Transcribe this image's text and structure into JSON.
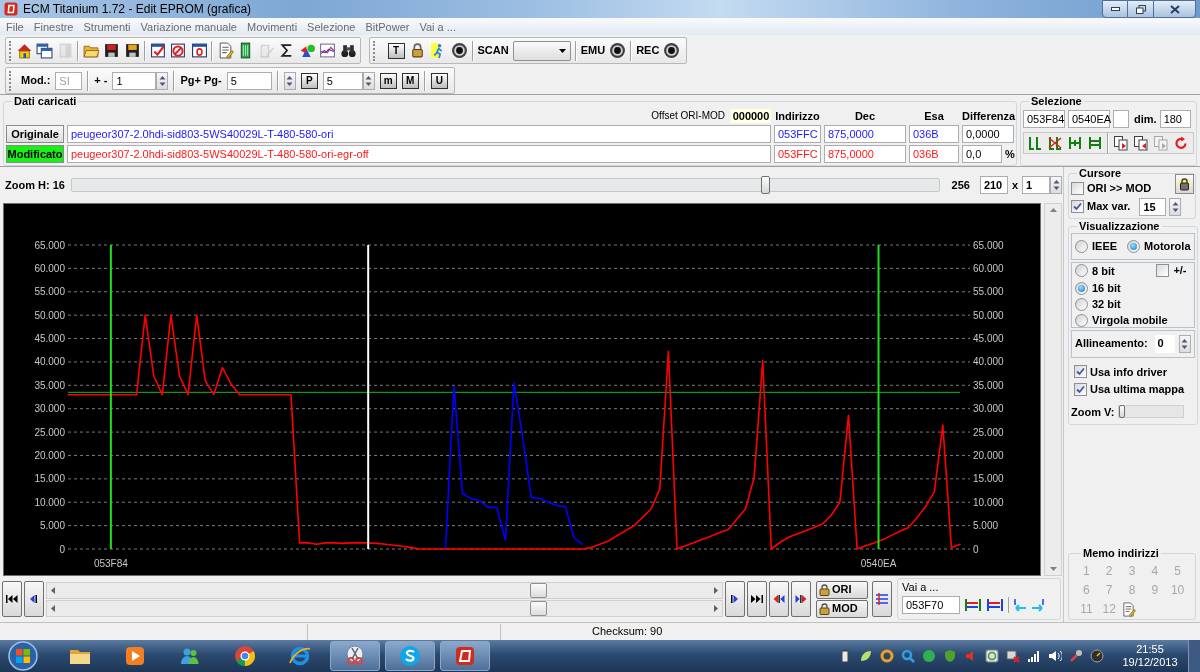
{
  "window": {
    "title": "ECM Titanium 1.72 - Edit EPROM (grafica)"
  },
  "menu": [
    "File",
    "Finestre",
    "Strumenti",
    "Variazione manuale",
    "Movimenti",
    "Selezione",
    "BitPower",
    "Vai a ..."
  ],
  "toolbar_1": {
    "buttons": [
      {
        "disabled": false
      },
      {
        "disabled": false
      },
      {
        "disabled": true
      },
      {
        "disabled": false
      },
      {
        "disabled": false
      },
      {
        "disabled": false
      },
      {
        "disabled": false
      },
      {
        "disabled": false
      },
      {
        "disabled": false
      },
      {
        "disabled": false
      },
      {
        "disabled": false
      },
      {
        "disabled": true
      },
      {
        "disabled": false
      },
      {
        "disabled": false
      },
      {
        "disabled": false
      },
      {
        "disabled": false
      }
    ],
    "letter_button": "T",
    "scan_label": "SCAN",
    "emu_label": "EMU",
    "rec_label": "REC"
  },
  "toolbar_2": {
    "mod": {
      "label": "Mod.:",
      "value": "SI",
      "disabled": true
    },
    "step": {
      "label": "+ -",
      "value": "1"
    },
    "page": {
      "label": "Pg+ Pg-",
      "value": "5"
    },
    "p_button": "P",
    "p_value": "5",
    "letter_buttons": [
      "m",
      "M",
      "U"
    ]
  },
  "loaded_data": {
    "title": "Dati caricati",
    "offset_label": "Offset ORI-MOD",
    "offset_value": "000000",
    "columns": [
      "Indirizzo",
      "Dec",
      "Esa",
      "Differenza"
    ],
    "rows": [
      {
        "kind": "original",
        "button": "Originale",
        "selected": false,
        "file": "peugeor307-2.0hdi-sid803-5WS40029L-T-480-580-ori",
        "address": "053FFC",
        "dec": "875,0000",
        "hex": "036B",
        "difference": "0,0000"
      },
      {
        "kind": "modified",
        "button": "Modificato",
        "selected": true,
        "file": "peugeor307-2.0hdi-sid803-5WS40029L-T-480-580-ori-egr-off",
        "address": "053FFC",
        "dec": "875,0000",
        "hex": "036B",
        "difference": "0,0",
        "unit": "%"
      }
    ]
  },
  "selection": {
    "title": "Selezione",
    "start": "053F84",
    "end": "0540EA",
    "dim_label": "dim.",
    "dim_value": "180",
    "tools": [
      {
        "disabled": false
      },
      {
        "disabled": false
      },
      {
        "disabled": false
      },
      {
        "disabled": false
      },
      {
        "disabled": false
      },
      {
        "disabled": false
      },
      {
        "disabled": true
      },
      {
        "disabled": false
      }
    ]
  },
  "zoom_h": {
    "label": "Zoom H: 16",
    "level": 0.8,
    "max": "256",
    "points": "210",
    "times": "x",
    "factor": "1"
  },
  "chart": {
    "markers": [
      {
        "label": "053F84"
      },
      {
        "label": "0540EA"
      }
    ],
    "chart_data": {
      "type": "line",
      "categories": [
        null,
        null,
        null,
        null,
        null,
        null,
        null,
        null,
        null,
        null,
        null,
        null,
        null,
        null,
        null,
        null,
        null,
        null,
        null,
        null,
        null,
        null,
        null,
        null,
        null,
        null,
        null,
        null,
        null,
        null,
        null,
        null,
        null,
        null,
        null,
        null,
        null,
        null,
        null,
        null,
        null,
        null,
        null,
        null,
        null,
        null,
        null,
        null,
        null,
        null,
        null,
        null,
        null,
        null,
        null,
        null,
        null,
        null,
        null,
        null,
        null,
        null,
        null,
        null,
        null,
        null,
        null,
        null,
        null,
        null,
        null,
        null,
        null,
        null,
        null,
        null,
        null,
        null,
        null,
        null,
        null,
        null,
        null,
        null,
        null,
        null,
        null,
        null,
        null,
        null,
        null,
        null,
        null,
        null,
        null,
        null,
        null,
        null,
        null,
        null,
        null,
        null,
        null,
        null,
        null
      ],
      "series": [
        {
          "color": "#0000ff",
          "values": [
            null,
            null,
            null,
            null,
            null,
            null,
            null,
            null,
            null,
            null,
            null,
            null,
            null,
            null,
            null,
            null,
            null,
            null,
            null,
            null,
            null,
            null,
            null,
            null,
            null,
            null,
            null,
            null,
            null,
            null,
            null,
            null,
            null,
            null,
            null,
            null,
            null,
            null,
            null,
            null,
            null,
            null,
            null,
            null,
            0,
            34.8,
            11.8,
            10.8,
            10.3,
            8.9,
            8.9,
            1.9,
            35.5,
            24,
            11,
            10.8,
            10,
            9.3,
            9,
            2.4,
            1,
            null,
            null,
            null,
            null,
            null,
            null,
            null,
            null,
            null,
            null,
            null,
            null,
            null,
            null,
            null,
            null,
            null,
            null,
            null,
            null,
            null,
            null,
            null,
            null,
            null,
            null,
            null,
            null,
            null,
            null,
            null,
            null,
            null,
            null,
            null,
            null,
            null,
            null,
            null,
            null,
            null,
            null,
            null,
            null
          ]
        },
        {
          "color": "#ff0000",
          "values": [
            33,
            33,
            33,
            33,
            33,
            33,
            33,
            33,
            33,
            50,
            37,
            33,
            50,
            37,
            33,
            50,
            36,
            33,
            38.8,
            35.3,
            33,
            33,
            33,
            33,
            33,
            33,
            33,
            1.3,
            1.3,
            1,
            1.3,
            1.3,
            1.2,
            1.3,
            1.3,
            1.3,
            1.2,
            1,
            0.8,
            0.6,
            0.3,
            0,
            0,
            0,
            0,
            0,
            0,
            0,
            0,
            0,
            0,
            0,
            0,
            0,
            0,
            0,
            0,
            0,
            0,
            0,
            0,
            0.3,
            1,
            1.7,
            2.8,
            3.9,
            5,
            6.8,
            8.6,
            12.8,
            42.3,
            0,
            0.7,
            1.4,
            2.1,
            2.8,
            3.5,
            4.2,
            6.4,
            8.6,
            15.4,
            40.3,
            0,
            1.4,
            2.5,
            3.2,
            3.9,
            4.6,
            5.4,
            7.2,
            10,
            28.6,
            0,
            0.7,
            1.3,
            2,
            2.9,
            3.8,
            4.6,
            6.7,
            9.1,
            12.2,
            26.5,
            0.3,
            1
          ]
        }
      ],
      "ylim": [
        0,
        65
      ],
      "yticks": [
        {
          "value": 0,
          "label": "0"
        },
        {
          "value": 5,
          "label": "5.000"
        },
        {
          "value": 10,
          "label": "10.000"
        },
        {
          "value": 15,
          "label": "15.000"
        },
        {
          "value": 20,
          "label": "20.000"
        },
        {
          "value": 25,
          "label": "25.000"
        },
        {
          "value": 30,
          "label": "30.000"
        },
        {
          "value": 35,
          "label": "35.000"
        },
        {
          "value": 40,
          "label": "40.000"
        },
        {
          "value": 45,
          "label": "45.000"
        },
        {
          "value": 50,
          "label": "50.000"
        },
        {
          "value": 55,
          "label": "55.000"
        },
        {
          "value": 60,
          "label": "60.000"
        },
        {
          "value": 65,
          "label": "65.000"
        }
      ],
      "grid": true,
      "ref_lines": [
        {
          "axis": "y",
          "value": 33.5
        }
      ]
    }
  },
  "navigation": {
    "ori_button": "ORI",
    "mod_button": "MOD",
    "goto": {
      "title": "Vai a ...",
      "value": "053F70"
    }
  },
  "cursor": {
    "title": "Cursore",
    "ori_to_mod": {
      "label": "ORI >> MOD",
      "checked": false
    },
    "max_var": {
      "label": "Max var.",
      "checked": true,
      "value": "15"
    }
  },
  "view": {
    "title": "Visualizzazione",
    "byte_order": [
      {
        "label": "IEEE",
        "selected": false
      },
      {
        "label": "Motorola",
        "selected": true
      }
    ],
    "format": [
      {
        "label": "8 bit",
        "selected": false
      },
      {
        "label": "16 bit",
        "selected": true
      },
      {
        "label": "32 bit",
        "selected": false
      },
      {
        "label": "Virgola mobile",
        "selected": false
      }
    ],
    "signed": {
      "label": "+/-",
      "checked": false
    },
    "alignment": {
      "label": "Allineamento:",
      "value": "0"
    },
    "options": [
      {
        "label": "Usa info driver",
        "checked": true
      },
      {
        "label": "Usa ultima mappa",
        "checked": true
      }
    ],
    "zoom_v": {
      "label": "Zoom V:",
      "level": 0
    }
  },
  "memo": {
    "title": "Memo indirizzi",
    "slots": [
      {
        "label": "1",
        "disabled": true
      },
      {
        "label": "2",
        "disabled": true
      },
      {
        "label": "3",
        "disabled": true
      },
      {
        "label": "4",
        "disabled": true
      },
      {
        "label": "5",
        "disabled": true
      },
      {
        "label": "6",
        "disabled": true
      },
      {
        "label": "7",
        "disabled": true
      },
      {
        "label": "8",
        "disabled": true
      },
      {
        "label": "9",
        "disabled": true
      },
      {
        "label": "10",
        "disabled": true
      },
      {
        "label": "11",
        "disabled": true
      },
      {
        "label": "12",
        "disabled": true
      }
    ]
  },
  "status_bar": {
    "checksum": "Checksum: 90"
  },
  "taskbar": {
    "apps": [
      {
        "active": false
      },
      {
        "active": false
      },
      {
        "active": false
      },
      {
        "active": false
      },
      {
        "active": false
      },
      {
        "active": true
      },
      {
        "active": true
      },
      {
        "active": true
      }
    ],
    "clock": {
      "time": "21:55",
      "date": "19/12/2013"
    }
  }
}
